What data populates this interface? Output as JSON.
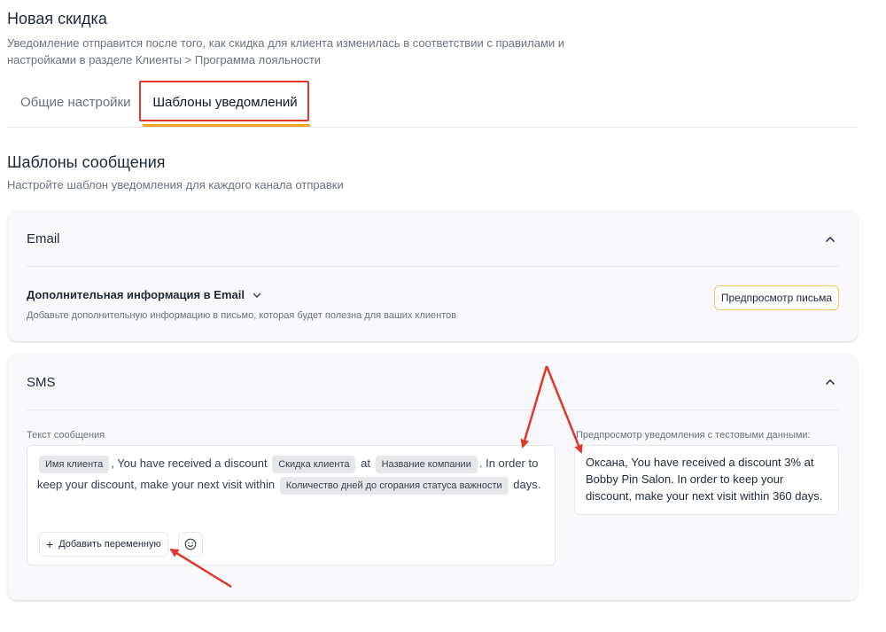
{
  "page": {
    "title": "Новая скидка",
    "description": "Уведомление отправится после того, как скидка для клиента изменилась в соответствии с правилами и настройками в разделе Клиенты > Программа лояльности"
  },
  "tabs": [
    {
      "label": "Общие настройки",
      "active": false
    },
    {
      "label": "Шаблоны уведомлений",
      "active": true
    }
  ],
  "section": {
    "title": "Шаблоны сообщения",
    "description": "Настройте шаблон уведомления для каждого канала отправки"
  },
  "email_card": {
    "title": "Email",
    "extra_info_title": "Дополнительная информация в Email",
    "extra_info_desc": "Добавьте дополнительную информацию в письмо, которая будет полезна для ваших клиентов",
    "preview_button": "Предпросмотр письма"
  },
  "sms_card": {
    "title": "SMS",
    "message_label": "Текст сообщения",
    "message": {
      "chip_client_name": "Имя клиента",
      "text_1": ", You have received a discount",
      "chip_discount": "Скидка клиента",
      "text_2": "at",
      "chip_company": "Название компании",
      "text_3": ". In order to keep your discount, make your next visit within",
      "chip_days": "Количество дней до сгорания статуса важности",
      "text_4": "days."
    },
    "add_variable_button": "Добавить переменную",
    "add_variable_icon": "+",
    "preview_label": "Предпросмотр уведомления с тестовыми данными:",
    "preview_text": "Оксана, You have received a discount 3% at Bobby Pin Salon. In order to keep your discount, make your next visit within 360 days."
  },
  "colors": {
    "active_tab_underline": "#f5a524",
    "highlight_border": "#e0392b",
    "annotation_arrow": "#e0392b",
    "card_bg": "#f8f8fa",
    "preview_button_border": "#f5c26b"
  },
  "icons": {
    "collapse": "chevron-up-icon",
    "expand": "chevron-down-icon",
    "add": "plus-icon",
    "emoji": "smiley-icon"
  }
}
